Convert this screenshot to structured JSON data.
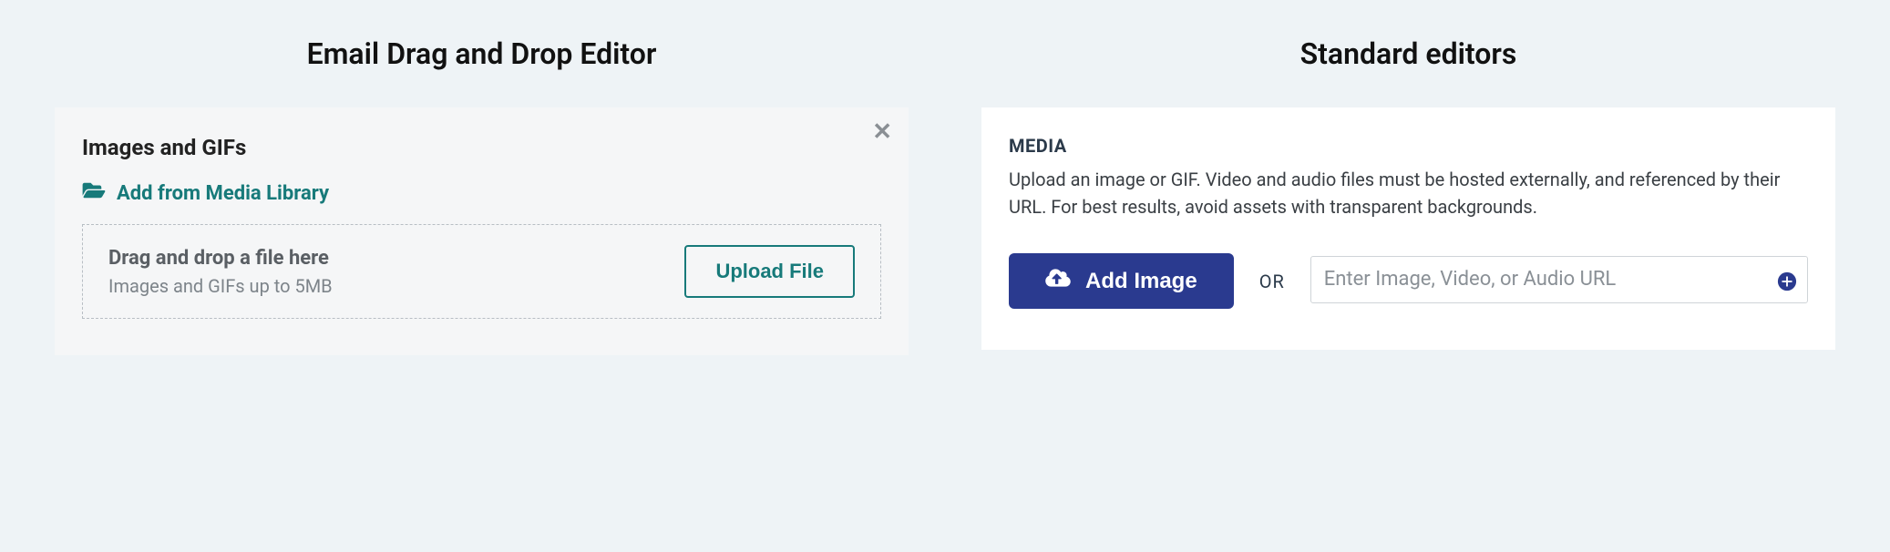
{
  "left": {
    "heading": "Email Drag and Drop Editor",
    "panel_title": "Images and GIFs",
    "media_library_link": "Add from Media Library",
    "dropzone_title": "Drag and drop a file here",
    "dropzone_subtitle": "Images and GIFs up to 5MB",
    "upload_button": "Upload File"
  },
  "right": {
    "heading": "Standard editors",
    "panel_title": "MEDIA",
    "panel_description": "Upload an image or GIF. Video and audio files must be hosted externally, and referenced by their URL. For best results, avoid assets with transparent backgrounds.",
    "add_image_button": "Add Image",
    "or_label": "OR",
    "url_placeholder": "Enter Image, Video, or Audio URL",
    "url_value": ""
  }
}
